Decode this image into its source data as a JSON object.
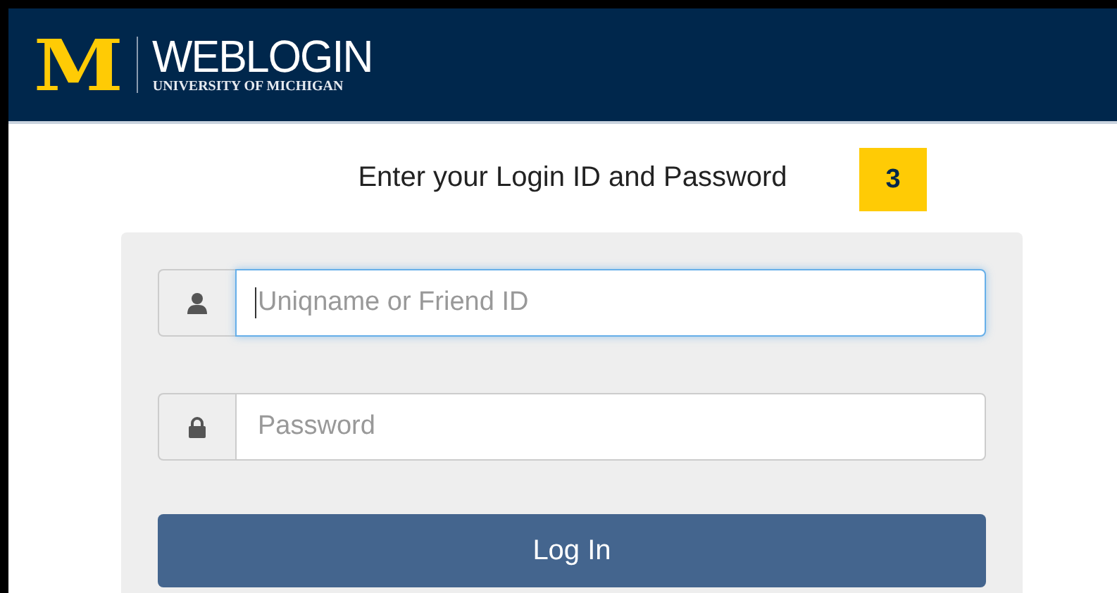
{
  "header": {
    "logo_letter": "M",
    "title": "WEBLOGIN",
    "subtitle": "UNIVERSITY OF MICHIGAN"
  },
  "heading": "Enter your Login ID and Password",
  "step_badge": "3",
  "fields": [
    {
      "kind": "user",
      "placeholder": "Uniqname or Friend ID",
      "focused": true
    },
    {
      "kind": "password",
      "placeholder": "Password",
      "focused": false
    }
  ],
  "login_button": "Log In"
}
